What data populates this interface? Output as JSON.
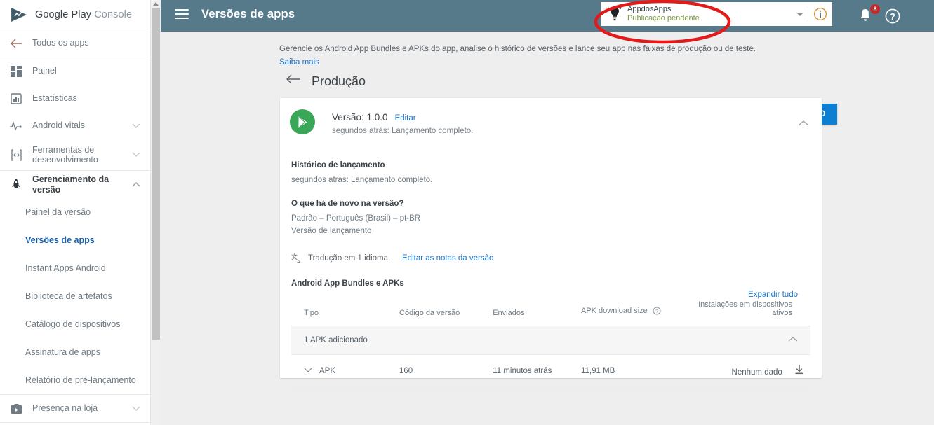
{
  "brand": {
    "part1": "Google Play",
    "part2": "Console",
    "logo_icon": "google-play-logo-icon"
  },
  "sidebar": {
    "back_item": {
      "label": "Todos os apps",
      "icon": "arrow-left-icon"
    },
    "items": [
      {
        "label": "Painel",
        "icon": "dashboard-icon",
        "chevron": ""
      },
      {
        "label": "Estatísticas",
        "icon": "bar-chart-icon",
        "chevron": ""
      },
      {
        "label": "Android vitals",
        "icon": "pulse-icon",
        "chevron": "chevron-down-icon"
      },
      {
        "label": "Ferramentas de desenvolvimento",
        "icon": "code-brackets-icon",
        "chevron": "chevron-down-icon"
      }
    ],
    "section": {
      "label": "Gerenciamento da versão",
      "icon": "rocket-icon",
      "chevron": "chevron-up-icon",
      "sub_items": [
        {
          "label": "Painel da versão",
          "selected": false
        },
        {
          "label": "Versões de apps",
          "selected": true
        },
        {
          "label": "Instant Apps Android",
          "selected": false
        },
        {
          "label": "Biblioteca de artefatos",
          "selected": false
        },
        {
          "label": "Catálogo de dispositivos",
          "selected": false
        },
        {
          "label": "Assinatura de apps",
          "selected": false
        },
        {
          "label": "Relatório de pré-lançamento",
          "selected": false
        }
      ]
    },
    "footer_item": {
      "label": "Presença na loja",
      "icon": "store-presence-icon",
      "chevron": "chevron-down-icon"
    }
  },
  "topbar": {
    "menu_icon": "hamburger-menu-icon",
    "title": "Versões de apps",
    "app_selector": {
      "icon": "app-bulb-icon",
      "name": "AppdosApps",
      "status": "Publicação pendente",
      "caret_icon": "caret-down-icon"
    },
    "info_icon": "info-circle-icon",
    "notifications": {
      "icon": "bell-icon",
      "badge": "8"
    },
    "help_icon": "help-question-icon",
    "avatar_icon": "android-avatar-icon"
  },
  "page": {
    "description": "Gerencie os Android App Bundles e APKs do app, analise o histórico de versões e lance seu app nas faixas de produção ou de teste.",
    "learn_more": "Saiba mais",
    "back_icon": "arrow-left-icon",
    "title": "Produção",
    "cta_label": "CRIAR UMA VERSÃO"
  },
  "release_card": {
    "play_icon": "google-play-triangle-icon",
    "version_label": "Versão: 1.0.0",
    "edit_link": "Editar",
    "subtitle": "segundos atrás: Lançamento completo.",
    "collapse_icon": "chevron-up-icon",
    "history": {
      "heading": "Histórico de lançamento",
      "text": "segundos atrás: Lançamento completo."
    },
    "whats_new": {
      "heading": "O que há de novo na versão?",
      "line1": "Padrão – Português (Brasil) – pt-BR",
      "line2": "Versão de lançamento"
    },
    "translation": {
      "icon": "translate-icon",
      "text": "Tradução em 1 idioma",
      "link": "Editar as notas da versão"
    },
    "bundles": {
      "heading": "Android App Bundles e APKs",
      "expand_all": "Expandir tudo",
      "columns": [
        "Tipo",
        "Código da versão",
        "Enviados",
        "APK download size",
        "Instalações em dispositivos ativos"
      ],
      "help_icon": "help-circle-icon",
      "group_row": {
        "label": "1 APK adicionado",
        "collapse_icon": "chevron-up-icon"
      },
      "rows": [
        {
          "expand_icon": "chevron-down-icon",
          "type": "APK",
          "version_code": "160",
          "uploaded": "11 minutos atrás",
          "download_size": "11,91 MB",
          "installs": "Nenhum dado",
          "download_icon": "download-icon"
        }
      ]
    }
  },
  "annotation": {
    "shape": "red-ellipse-highlight",
    "color": "#e01b1b"
  },
  "colors": {
    "topbar": "#577a8a",
    "accent_blue": "#0d7fd3",
    "link_blue": "#1a73c8",
    "play_green": "#3aa657",
    "status_green": "#7b9a3f",
    "badge_red": "#c62828",
    "page_bg": "#eeeeee"
  }
}
